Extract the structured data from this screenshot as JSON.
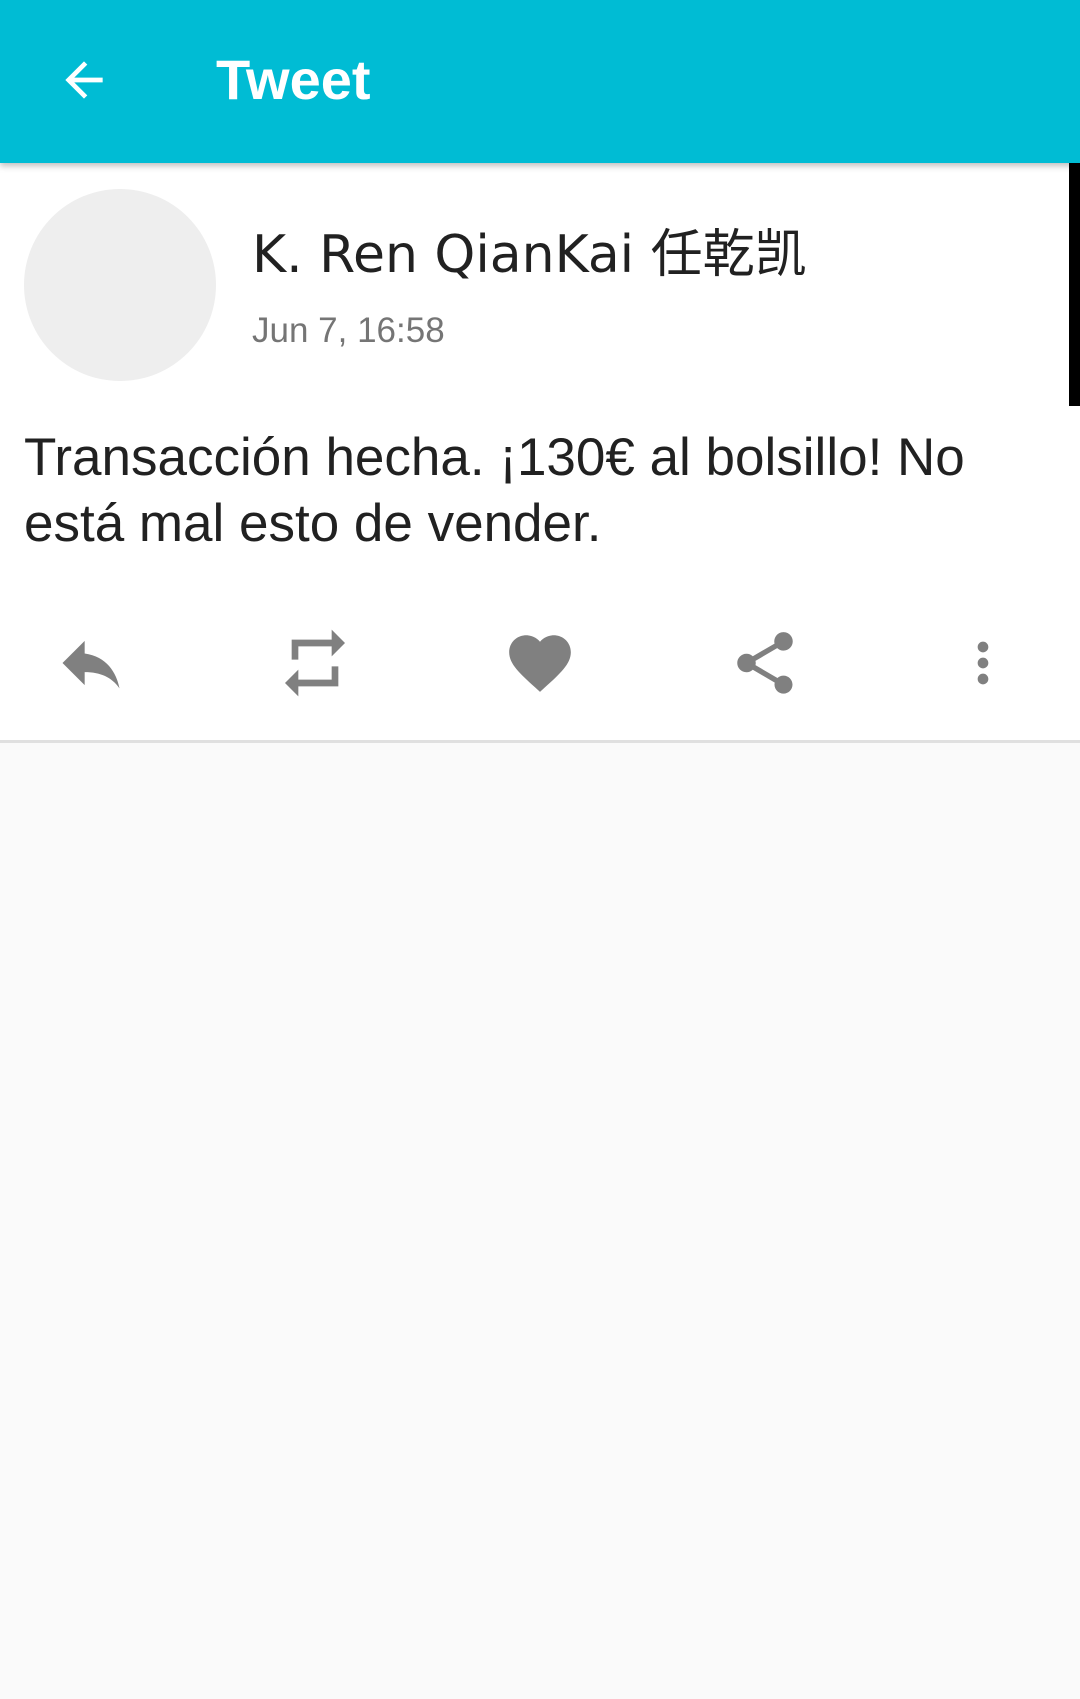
{
  "app_bar": {
    "title": "Tweet",
    "back_icon": "arrow-back-icon",
    "color": "#00bcd4"
  },
  "tweet": {
    "author_name": "K. Ren QianKai 任乾凯",
    "timestamp": "Jun 7, 16:58",
    "text": "Transacción hecha. ¡130€ al bolsillo! No está mal esto de vender."
  },
  "actions": [
    {
      "name": "reply",
      "icon": "reply-icon"
    },
    {
      "name": "retweet",
      "icon": "retweet-icon"
    },
    {
      "name": "like",
      "icon": "heart-icon"
    },
    {
      "name": "share",
      "icon": "share-icon"
    },
    {
      "name": "more",
      "icon": "more-vert-icon"
    }
  ],
  "colors": {
    "icon_gray": "#808080",
    "background": "#fafafa"
  }
}
